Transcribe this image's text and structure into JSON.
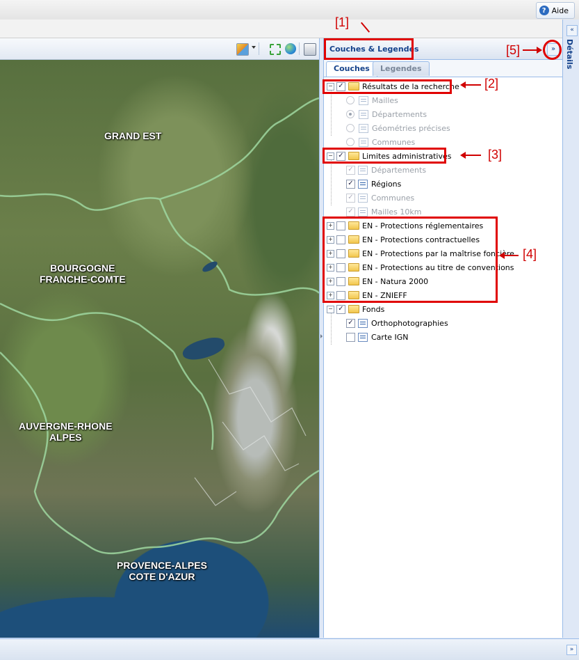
{
  "top_bar": {
    "help_label": "Aide",
    "help_icon": "help-question-icon"
  },
  "map": {
    "regions": [
      "GRAND EST",
      "BOURGOGNE\nFRANCHE-COMTE",
      "AUVERGNE-RHONE\nALPES",
      "PROVENCE-ALPES\nCOTE D'AZUR"
    ],
    "toolbar_icons": [
      "layer-legend-icon",
      "dropdown-arrow-icon",
      "zoom-extent-icon",
      "globe-icon",
      "print-icon"
    ]
  },
  "panel": {
    "title": "Couches & Legendes",
    "collapse_label": "»",
    "tabs": [
      "Couches",
      "Legendes"
    ],
    "tree": [
      {
        "label": "Résultats de la recherche",
        "type": "folder",
        "checked": true,
        "expanded": true
      },
      {
        "label": "Mailles",
        "type": "radio",
        "disabled": true
      },
      {
        "label": "Départements",
        "type": "radio",
        "selected": true,
        "disabled": true
      },
      {
        "label": "Géométries précises",
        "type": "radio",
        "disabled": true
      },
      {
        "label": "Communes",
        "type": "radio",
        "disabled": true
      },
      {
        "label": "Limites administratives",
        "type": "folder",
        "checked": true,
        "expanded": true
      },
      {
        "label": "Départements",
        "type": "check",
        "checked": true,
        "disabled": true
      },
      {
        "label": "Régions",
        "type": "check",
        "checked": true
      },
      {
        "label": "Communes",
        "type": "check",
        "checked": true,
        "disabled": true
      },
      {
        "label": "Mailles 10km",
        "type": "check",
        "checked": true,
        "disabled": true
      },
      {
        "label": "EN - Protections réglementaires",
        "type": "folder",
        "checked": false
      },
      {
        "label": "EN - Protections contractuelles",
        "type": "folder",
        "checked": false
      },
      {
        "label": "EN - Protections par la maîtrise foncière",
        "type": "folder",
        "checked": false
      },
      {
        "label": "EN - Protections au titre de conventions",
        "type": "folder",
        "checked": false
      },
      {
        "label": "EN - Natura 2000",
        "type": "folder",
        "checked": false
      },
      {
        "label": "EN - ZNIEFF",
        "type": "folder",
        "checked": false
      },
      {
        "label": "Fonds",
        "type": "folder",
        "checked": true,
        "expanded": true
      },
      {
        "label": "Orthophotographies",
        "type": "check",
        "checked": true
      },
      {
        "label": "Carte IGN",
        "type": "check",
        "checked": false
      }
    ]
  },
  "details": {
    "label": "Détails",
    "expand_label": "«"
  },
  "bottom": {
    "expand_label": "»"
  },
  "annotations": [
    "[1]",
    "[2]",
    "[3]",
    "[4]",
    "[5]"
  ],
  "colors": {
    "annotation": "#e00000",
    "header_text": "#15428b",
    "border": "#99bbe8"
  }
}
